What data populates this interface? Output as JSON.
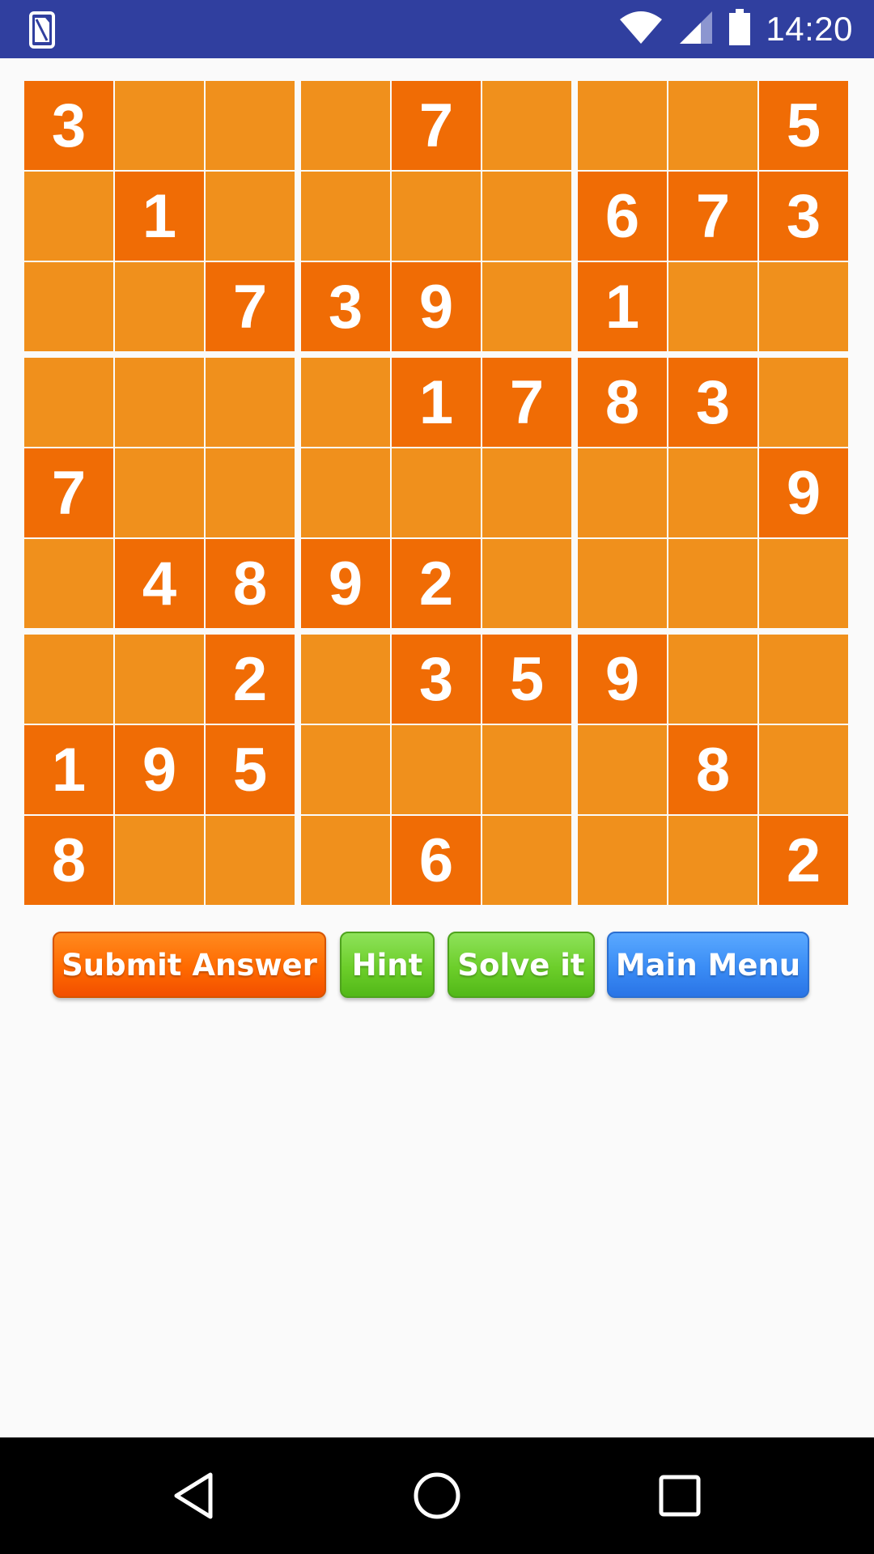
{
  "status_bar": {
    "time": "14:20",
    "icons": [
      "sim-card-icon",
      "wifi-icon",
      "cell-signal-icon",
      "battery-icon"
    ],
    "background": "#303f9f"
  },
  "sudoku": {
    "rows": [
      [
        "3",
        "",
        "",
        "",
        "7",
        "",
        "",
        "",
        "5"
      ],
      [
        "",
        "1",
        "",
        "",
        "",
        "",
        "6",
        "7",
        "3"
      ],
      [
        "",
        "",
        "7",
        "3",
        "9",
        "",
        "1",
        "",
        ""
      ],
      [
        "",
        "",
        "",
        "",
        "1",
        "7",
        "8",
        "3",
        ""
      ],
      [
        "7",
        "",
        "",
        "",
        "",
        "",
        "",
        "",
        "9"
      ],
      [
        "",
        "4",
        "8",
        "9",
        "2",
        "",
        "",
        "",
        ""
      ],
      [
        "",
        "",
        "2",
        "",
        "3",
        "5",
        "9",
        "",
        ""
      ],
      [
        "1",
        "9",
        "5",
        "",
        "",
        "",
        "",
        "8",
        ""
      ],
      [
        "8",
        "",
        "",
        "",
        "6",
        "",
        "",
        "",
        "2"
      ]
    ],
    "given_color": "#f06c05",
    "empty_color": "#f0901c",
    "digit_color": "#ffffff"
  },
  "buttons": {
    "submit": "Submit Answer",
    "hint": "Hint",
    "solve": "Solve it",
    "menu": "Main Menu"
  },
  "nav_bar": {
    "icons": [
      "back-icon",
      "home-icon",
      "recents-icon"
    ]
  }
}
